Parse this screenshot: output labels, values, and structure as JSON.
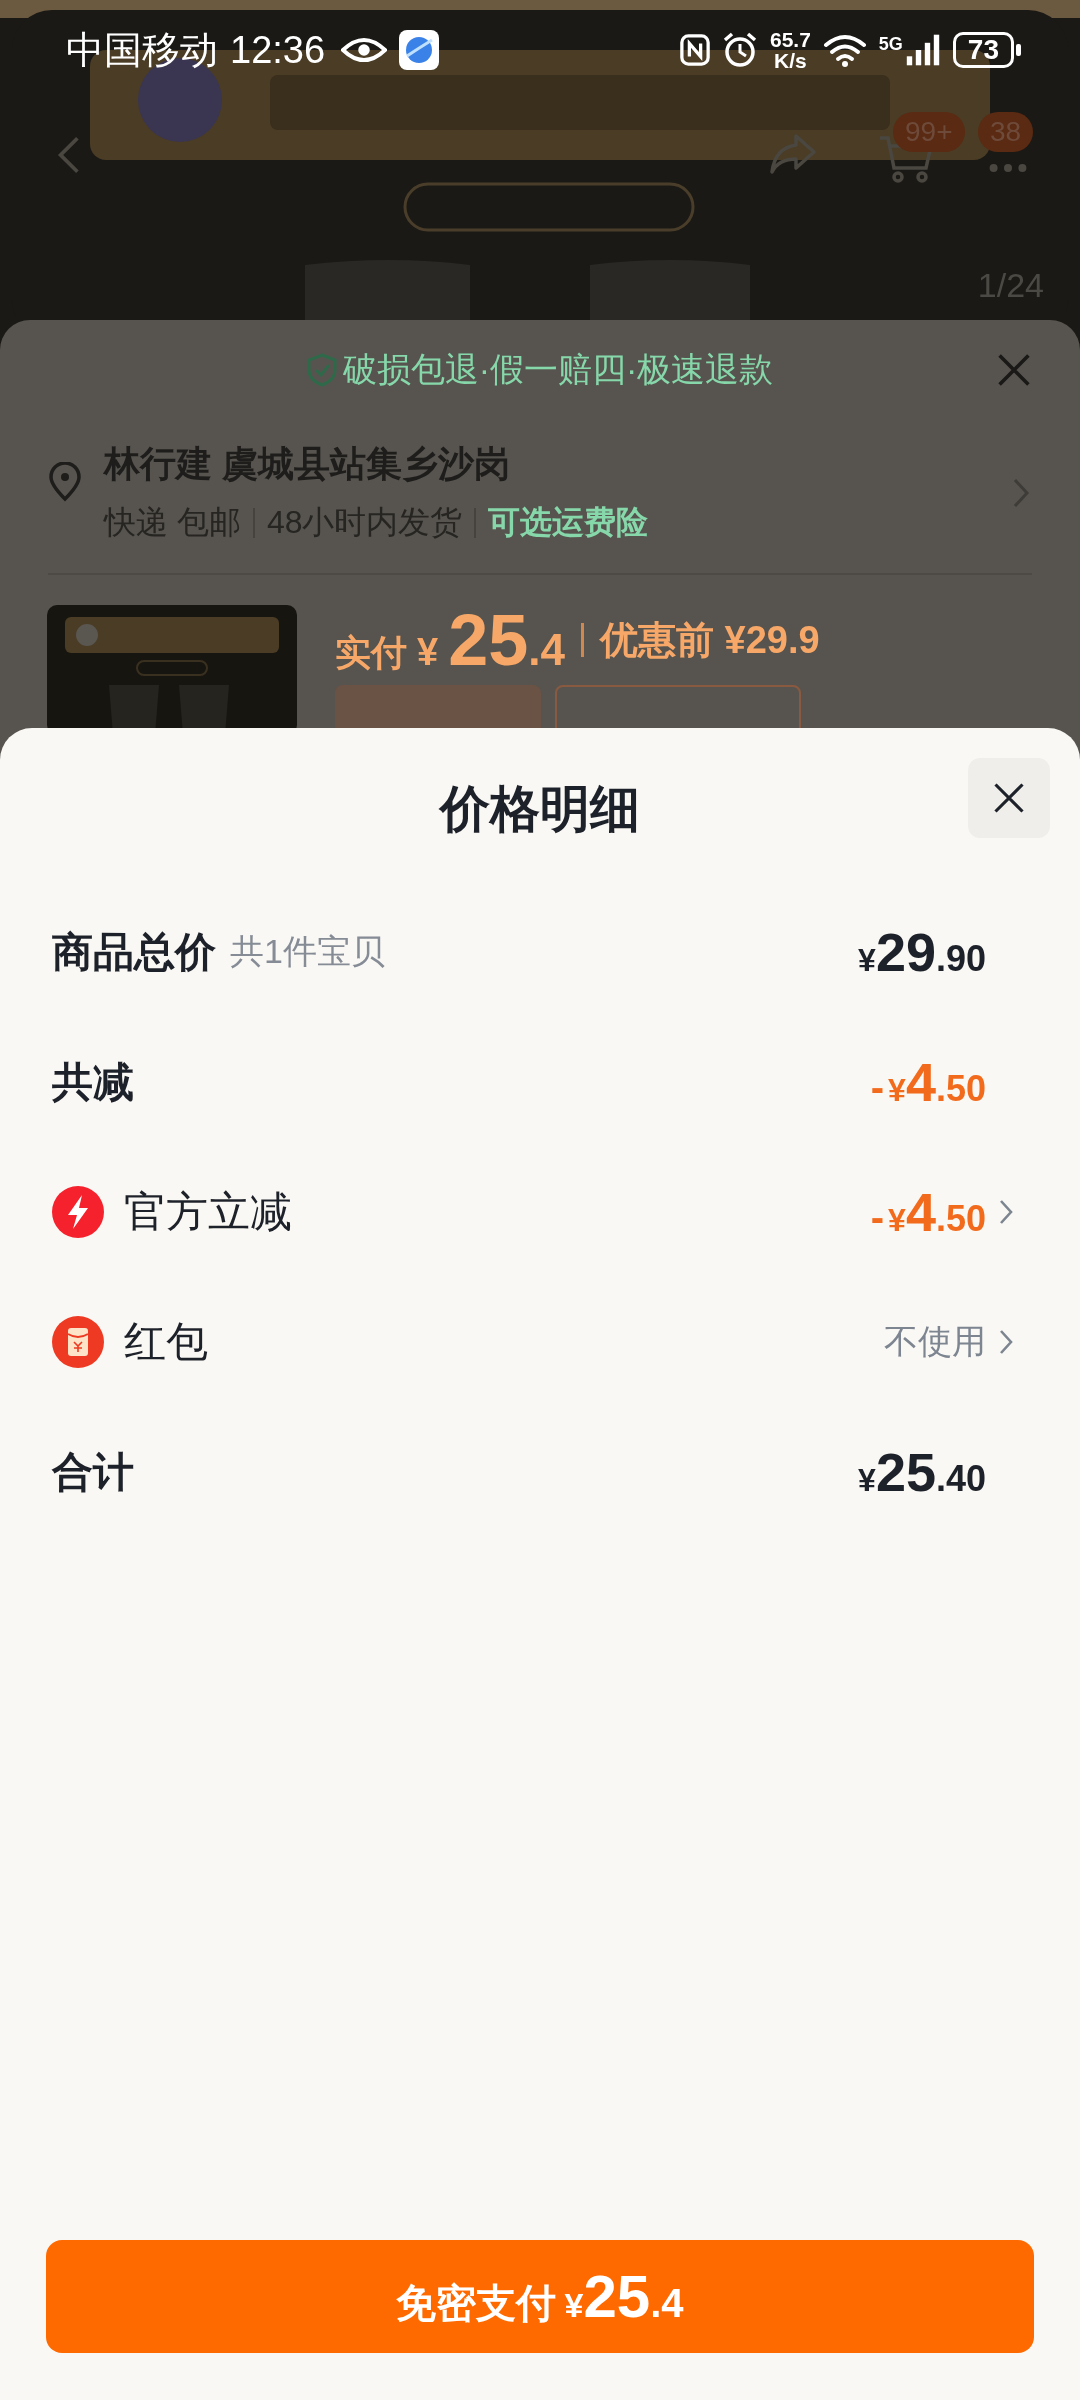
{
  "status_bar": {
    "carrier": "中国移动",
    "time": "12:36",
    "speed_value": "65.7",
    "speed_unit": "K/s",
    "network": "5G",
    "battery": "73"
  },
  "product_page": {
    "cart_badge": "99+",
    "message_badge": "38",
    "image_counter": "1/24"
  },
  "order_sheet": {
    "guarantee": "破损包退·假一赔四·极速退款",
    "address": "林行建 虞城县站集乡沙岗",
    "delivery": [
      {
        "text": "快递 包邮",
        "highlighted": false
      },
      {
        "text": "48小时内发货",
        "highlighted": false
      },
      {
        "text": "可选运费险",
        "highlighted": true
      }
    ],
    "price": {
      "label": "实付",
      "currency": "¥",
      "integer": "25",
      "decimal": ".4",
      "original": "优惠前 ¥29.9"
    }
  },
  "price_sheet": {
    "title": "价格明细",
    "rows": [
      {
        "kind": "bold",
        "label": "商品总价",
        "note": "共1件宝贝",
        "amount": {
          "currency": "¥",
          "integer": "29",
          "decimal": ".90"
        },
        "discount": false,
        "chevron": false
      },
      {
        "kind": "bold",
        "label": "共减",
        "amount": {
          "sign": "-",
          "currency": "¥",
          "integer": "4",
          "decimal": ".50"
        },
        "discount": true,
        "chevron": false
      },
      {
        "kind": "lightning",
        "label": "官方立减",
        "amount": {
          "sign": "-",
          "currency": "¥",
          "integer": "4",
          "decimal": ".50"
        },
        "discount": true,
        "chevron": true
      },
      {
        "kind": "red_packet",
        "label": "红包",
        "value": "不使用",
        "discount": false,
        "chevron": true
      },
      {
        "kind": "bold",
        "label": "合计",
        "amount": {
          "currency": "¥",
          "integer": "25",
          "decimal": ".40"
        },
        "discount": false,
        "chevron": false
      }
    ],
    "pay_button": {
      "label": "免密支付",
      "currency": "¥",
      "integer": "25",
      "decimal": ".4"
    }
  }
}
